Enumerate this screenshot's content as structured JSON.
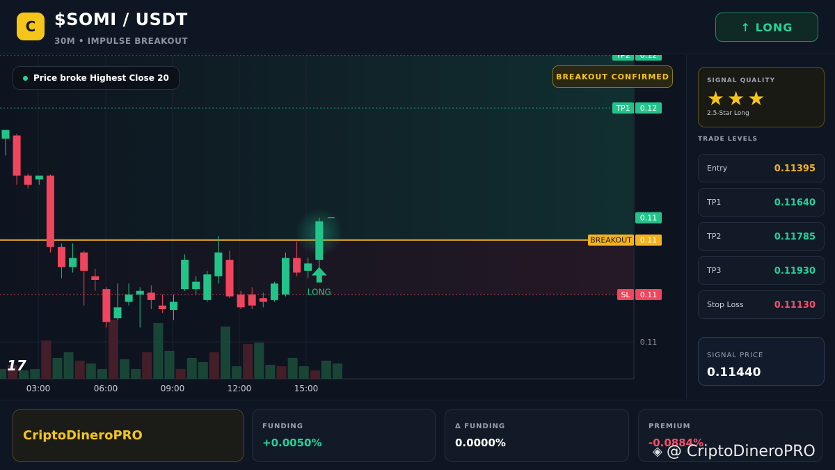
{
  "header": {
    "logo_letter": "C",
    "pair": "$SOMI / USDT",
    "subtitle": "30M • IMPULSE BREAKOUT",
    "action_label": "↑ LONG"
  },
  "chart": {
    "legend": "Price broke Highest Close 20",
    "badge": "BREAKOUT CONFIRMED",
    "tv_logo": "17",
    "signal_label": "LONG",
    "price_tags": [
      {
        "label": "TP2",
        "value": "0.12"
      },
      {
        "label": "TP1",
        "value": "0.12"
      },
      {
        "label": "",
        "value": "0.11"
      },
      {
        "label": "BREAKOUT",
        "value": "0.11"
      },
      {
        "label": "SL",
        "value": "0.11"
      }
    ],
    "volume_axis_label": "0.11",
    "time_labels": [
      "03:00",
      "06:00",
      "09:00",
      "12:00",
      "15:00"
    ]
  },
  "chart_data": {
    "type": "candlestick",
    "candles": [
      {
        "o": 0.11556,
        "h": 0.1158,
        "l": 0.1151,
        "c": 0.1158
      },
      {
        "o": 0.11565,
        "h": 0.1157,
        "l": 0.1143,
        "c": 0.11455
      },
      {
        "o": 0.11455,
        "h": 0.1146,
        "l": 0.1142,
        "c": 0.1143
      },
      {
        "o": 0.11445,
        "h": 0.1145,
        "l": 0.1143,
        "c": 0.11455
      },
      {
        "o": 0.11455,
        "h": 0.11458,
        "l": 0.11245,
        "c": 0.1126
      },
      {
        "o": 0.1126,
        "h": 0.1127,
        "l": 0.11175,
        "c": 0.11205
      },
      {
        "o": 0.11205,
        "h": 0.1127,
        "l": 0.1119,
        "c": 0.1123
      },
      {
        "o": 0.11245,
        "h": 0.1125,
        "l": 0.111,
        "c": 0.11195
      },
      {
        "o": 0.1118,
        "h": 0.112,
        "l": 0.1114,
        "c": 0.1117
      },
      {
        "o": 0.11145,
        "h": 0.1115,
        "l": 0.1104,
        "c": 0.11055
      },
      {
        "o": 0.11065,
        "h": 0.1116,
        "l": 0.1106,
        "c": 0.11095
      },
      {
        "o": 0.1111,
        "h": 0.1116,
        "l": 0.111,
        "c": 0.1113
      },
      {
        "o": 0.1113,
        "h": 0.1115,
        "l": 0.1104,
        "c": 0.1114
      },
      {
        "o": 0.11135,
        "h": 0.11155,
        "l": 0.1109,
        "c": 0.11115
      },
      {
        "o": 0.111,
        "h": 0.1113,
        "l": 0.1108,
        "c": 0.1109
      },
      {
        "o": 0.11088,
        "h": 0.1113,
        "l": 0.1106,
        "c": 0.1111
      },
      {
        "o": 0.11145,
        "h": 0.1124,
        "l": 0.1114,
        "c": 0.11225
      },
      {
        "o": 0.11145,
        "h": 0.1118,
        "l": 0.1113,
        "c": 0.11165
      },
      {
        "o": 0.11115,
        "h": 0.11195,
        "l": 0.1111,
        "c": 0.11185
      },
      {
        "o": 0.1118,
        "h": 0.1129,
        "l": 0.1116,
        "c": 0.11245
      },
      {
        "o": 0.11225,
        "h": 0.1125,
        "l": 0.1112,
        "c": 0.11125
      },
      {
        "o": 0.1113,
        "h": 0.1114,
        "l": 0.1109,
        "c": 0.11095
      },
      {
        "o": 0.1113,
        "h": 0.1115,
        "l": 0.1109,
        "c": 0.111
      },
      {
        "o": 0.1112,
        "h": 0.11135,
        "l": 0.11095,
        "c": 0.1111
      },
      {
        "o": 0.11115,
        "h": 0.11165,
        "l": 0.1111,
        "c": 0.1116
      },
      {
        "o": 0.1113,
        "h": 0.11245,
        "l": 0.11125,
        "c": 0.1123
      },
      {
        "o": 0.1123,
        "h": 0.11275,
        "l": 0.1118,
        "c": 0.1119
      },
      {
        "o": 0.11195,
        "h": 0.1123,
        "l": 0.11175,
        "c": 0.11215
      },
      {
        "o": 0.11225,
        "h": 0.1134,
        "l": 0.112,
        "c": 0.1133
      }
    ],
    "volumes": [
      14,
      20,
      12,
      14,
      55,
      30,
      38,
      26,
      22,
      14,
      85,
      28,
      14,
      38,
      80,
      40,
      14,
      30,
      24,
      38,
      75,
      18,
      50,
      52,
      20,
      18,
      30,
      18,
      12,
      26,
      22
    ],
    "xlabels": [
      "03:00",
      "06:00",
      "09:00",
      "12:00",
      "15:00"
    ],
    "levels": {
      "tp2": 0.11785,
      "tp1": 0.1164,
      "entry": 0.11395,
      "breakout": 0.11279,
      "sl": 0.1113
    }
  },
  "panel": {
    "quality_label": "SIGNAL QUALITY",
    "stars": "★★★",
    "quality_note": "2.5-Star Long",
    "levels_title": "TRADE LEVELS",
    "levels": [
      {
        "key": "Entry",
        "value": "0.11395",
        "color": "#f5b21b"
      },
      {
        "key": "TP1",
        "value": "0.11640",
        "color": "#22d39a"
      },
      {
        "key": "TP2",
        "value": "0.11785",
        "color": "#22d39a"
      },
      {
        "key": "TP3",
        "value": "0.11930",
        "color": "#22d39a"
      },
      {
        "key": "Stop Loss",
        "value": "0.11130",
        "color": "#ff4d6a"
      }
    ],
    "signal_price_label": "SIGNAL PRICE",
    "signal_price": "0.11440"
  },
  "footer": {
    "brand": "CriptoDineroPRO",
    "funding_label": "FUNDING",
    "funding_value": "+0.0050%",
    "dfunding_label": "Δ FUNDING",
    "dfunding_value": "0.0000%",
    "premium_label": "PREMIUM",
    "premium_value": "-0.0884%",
    "watermark": "@ CriptoDineroPRO"
  },
  "colors": {
    "up": "#22c48a",
    "down": "#f0455c",
    "accent": "#f5c518"
  }
}
